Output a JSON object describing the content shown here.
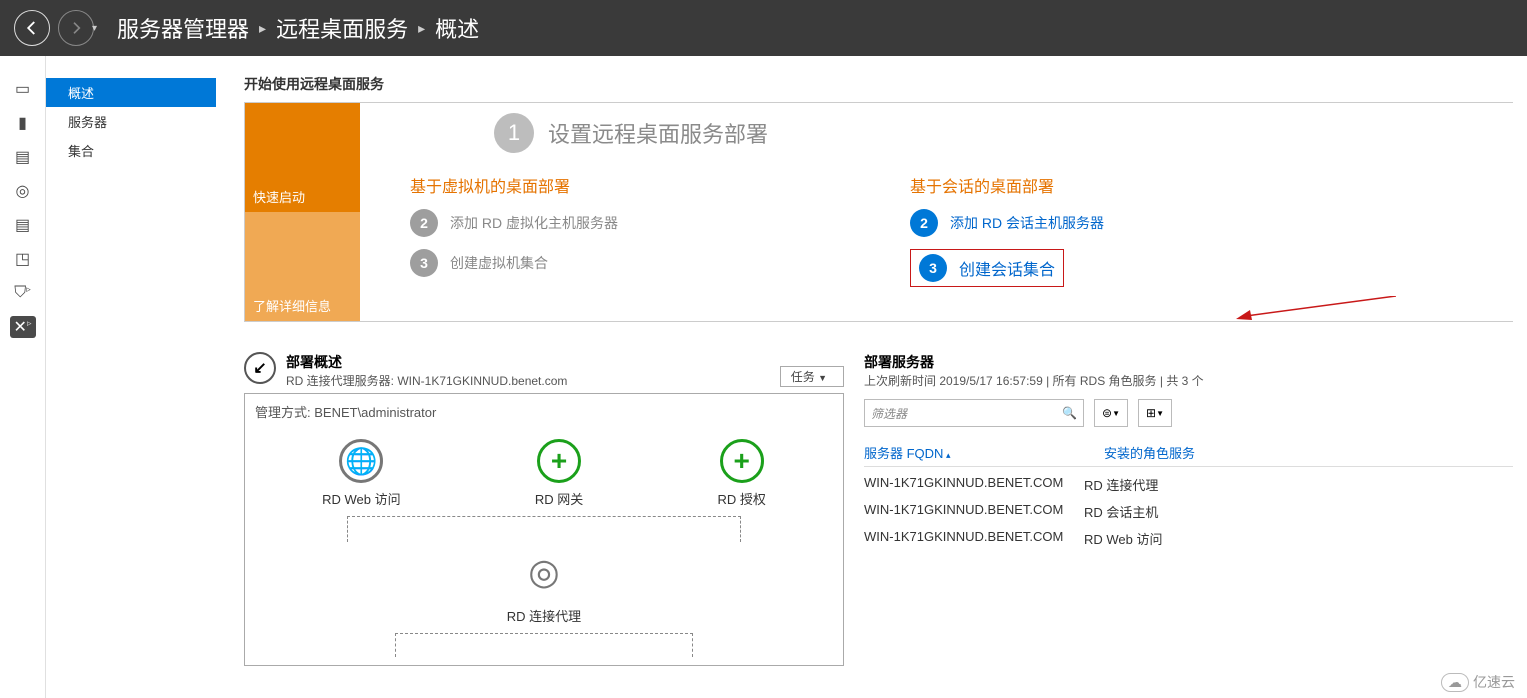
{
  "header": {
    "app": "服务器管理器",
    "bc2": "远程桌面服务",
    "bc3": "概述"
  },
  "sidebar": {
    "items": [
      {
        "label": "概述"
      },
      {
        "label": "服务器"
      },
      {
        "label": "集合"
      }
    ]
  },
  "quickstart": {
    "title": "开始使用远程桌面服务",
    "tile1": "快速启动",
    "tile2": "了解详细信息",
    "big_step_num": "1",
    "big_step_text": "设置远程桌面服务部署",
    "left_col": {
      "heading": "基于虚拟机的桌面部署",
      "s2": "添加 RD 虚拟化主机服务器",
      "s3": "创建虚拟机集合"
    },
    "right_col": {
      "heading": "基于会话的桌面部署",
      "s2": "添加 RD 会话主机服务器",
      "s3": "创建会话集合"
    }
  },
  "deploy_overview": {
    "title": "部署概述",
    "sub": "RD 连接代理服务器: WIN-1K71GKINNUD.benet.com",
    "tasks": "任务",
    "mgmt": "管理方式: BENET\\administrator",
    "nodes": {
      "web": "RD Web 访问",
      "gw": "RD 网关",
      "lic": "RD 授权",
      "cb": "RD 连接代理"
    }
  },
  "deploy_servers": {
    "title": "部署服务器",
    "sub": "上次刷新时间 2019/5/17 16:57:59 | 所有 RDS 角色服务 | 共 3 个",
    "filter_placeholder": "筛选器",
    "columns": {
      "fqdn": "服务器 FQDN",
      "role": "安装的角色服务"
    },
    "rows": [
      {
        "fqdn": "WIN-1K71GKINNUD.BENET.COM",
        "role": "RD 连接代理"
      },
      {
        "fqdn": "WIN-1K71GKINNUD.BENET.COM",
        "role": "RD 会话主机"
      },
      {
        "fqdn": "WIN-1K71GKINNUD.BENET.COM",
        "role": "RD Web 访问"
      }
    ]
  },
  "watermark": "亿速云"
}
